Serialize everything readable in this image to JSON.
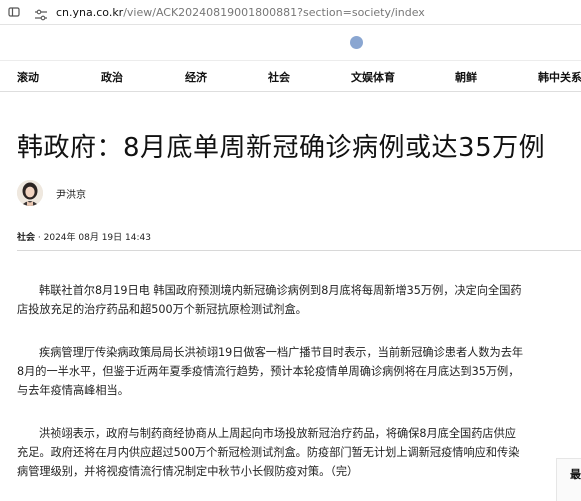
{
  "browser": {
    "url_host": "cn.yna.co.kr",
    "url_path": "/view/ACK20240819001800881?section=society/index"
  },
  "nav": {
    "items": [
      "滚动",
      "政治",
      "经济",
      "社会",
      "文娱体育",
      "朝鲜",
      "韩中关系"
    ]
  },
  "article": {
    "title": "韩政府：8月底单周新冠确诊病例或达35万例",
    "author": "尹洪京",
    "section": "社会",
    "date": "2024年 08月 19日 14:43",
    "paragraphs": [
      "韩联社首尔8月19日电 韩国政府预测境内新冠确诊病例到8月底将每周新增35万例，决定向全国药店投放充足的治疗药品和超500万个新冠抗原检测试剂盒。",
      "疾病管理厅传染病政策局局长洪祯翊19日做客一档广播节目时表示，当前新冠确诊患者人数为去年8月的一半水平，但鉴于近两年夏季疫情流行趋势，预计本轮疫情单周确诊病例将在月底达到35万例，与去年疫情高峰相当。",
      "洪祯翊表示，政府与制药商经协商从上周起向市场投放新冠治疗药品，将确保8月底全国药店供应充足。政府还将在月内供应超过500万个新冠检测试剂盒。防疫部门暂无计划上调新冠疫情响应和传染病管理级别，并将视疫情流行情况制定中秋节小长假防疫对策。（完）"
    ]
  },
  "side": {
    "label": "最"
  },
  "colors": {
    "logo": "#8aa6d1",
    "accent": "#111111"
  }
}
